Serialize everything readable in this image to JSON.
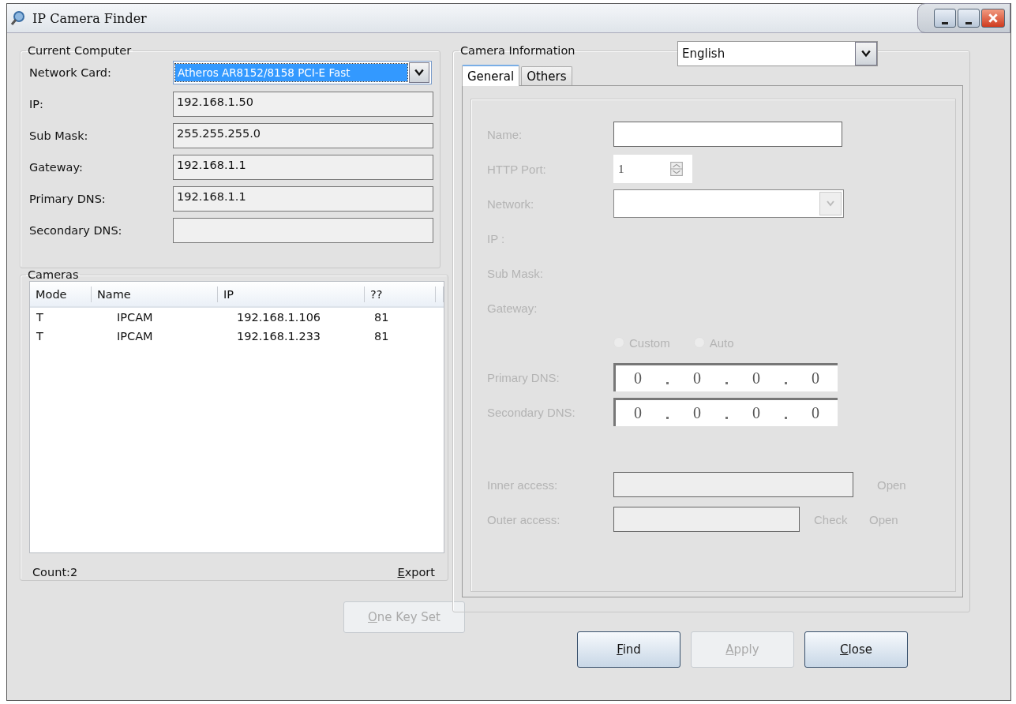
{
  "window": {
    "title": "IP Camera Finder"
  },
  "current_computer": {
    "title": "Current Computer",
    "fields": [
      {
        "label": "Network Card:",
        "kind": "dropdown",
        "value": "Atheros AR8152/8158 PCI-E Fast"
      },
      {
        "label": "IP:",
        "kind": "text",
        "value": "192.168.1.50"
      },
      {
        "label": "Sub Mask:",
        "kind": "text",
        "value": "255.255.255.0"
      },
      {
        "label": "Gateway:",
        "kind": "text",
        "value": "192.168.1.1"
      },
      {
        "label": "Primary DNS:",
        "kind": "text",
        "value": "192.168.1.1"
      },
      {
        "label": "Secondary DNS:",
        "kind": "text"
      }
    ]
  },
  "cameras": {
    "title": "Cameras",
    "columns": [
      "Mode",
      "Name",
      "IP",
      "??"
    ],
    "rows": [
      {
        "cells": [
          "T",
          "IPCAM",
          "192.168.1.106",
          "81"
        ]
      },
      {
        "cells": [
          "T",
          "IPCAM",
          "192.168.1.233",
          "81"
        ]
      }
    ],
    "count": "Count:2",
    "export": "Export"
  },
  "camera_information": {
    "title": "Camera Information",
    "language": "English",
    "disabled": true,
    "tabs": [
      {
        "label": "General",
        "selected": true
      },
      {
        "label": "Others",
        "selected": false
      }
    ],
    "fields": [
      {
        "label": "Name:",
        "kind": "text"
      },
      {
        "label": "HTTP Port:",
        "kind": "spinner",
        "value": "1"
      },
      {
        "label": "Network:",
        "kind": "dropdown"
      },
      {
        "label": "IP :",
        "kind": "label"
      },
      {
        "label": "Sub Mask:",
        "kind": "label"
      },
      {
        "label": "Gateway:",
        "kind": "label"
      },
      {
        "kind": "radios",
        "options": [
          {
            "label": "Custom",
            "selected": false
          },
          {
            "label": "Auto",
            "selected": false
          }
        ]
      },
      {
        "label": "Primary DNS:",
        "kind": "ip",
        "octets": [
          "0",
          "0",
          "0",
          "0"
        ]
      },
      {
        "label": "Secondary DNS:",
        "kind": "ip",
        "octets": [
          "0",
          "0",
          "0",
          "0"
        ]
      },
      {
        "kind": "spacer"
      },
      {
        "label": "Inner access:",
        "kind": "access",
        "links": [
          "Open"
        ]
      },
      {
        "label": "Outer access:",
        "kind": "access",
        "links": [
          "Check",
          "Open"
        ]
      }
    ]
  },
  "one_key_set": {
    "label": "One Key Set",
    "disabled": true
  },
  "buttons": [
    {
      "label": "Find",
      "disabled": false
    },
    {
      "label": "Apply",
      "disabled": true
    },
    {
      "label": "Close",
      "disabled": false
    }
  ]
}
